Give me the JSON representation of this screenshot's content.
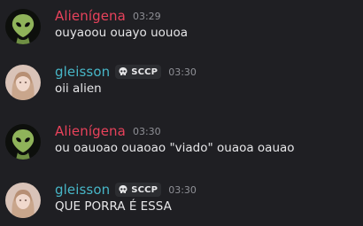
{
  "messages": [
    {
      "author": "Alienígena",
      "author_color": "#e8425b",
      "avatar": "alien-avatar",
      "tag": null,
      "timestamp": "03:29",
      "text": "ouyaoou ouayo uouoa"
    },
    {
      "author": "gleisson",
      "author_color": "#47b6c7",
      "avatar": "girl-avatar",
      "tag": {
        "icon": "skull-icon",
        "label": "SCCP"
      },
      "timestamp": "03:30",
      "text": "oii alien"
    },
    {
      "author": "Alienígena",
      "author_color": "#e8425b",
      "avatar": "alien-avatar",
      "tag": null,
      "timestamp": "03:30",
      "text": "ou oauoao ouaoao \"viado\" ouaoa oauao"
    },
    {
      "author": "gleisson",
      "author_color": "#47b6c7",
      "avatar": "girl-avatar",
      "tag": {
        "icon": "skull-icon",
        "label": "SCCP"
      },
      "timestamp": "03:30",
      "text": "QUE PORRA É ESSA"
    }
  ]
}
